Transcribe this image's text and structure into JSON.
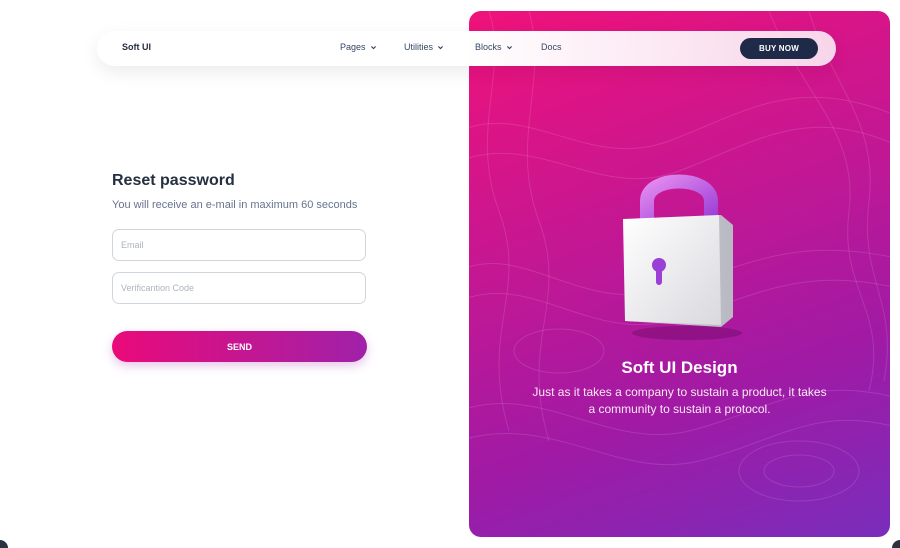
{
  "nav": {
    "brand": "Soft UI",
    "items": [
      {
        "label": "Pages",
        "icon": "chevron-down-icon"
      },
      {
        "label": "Utilities",
        "icon": "chevron-down-icon"
      },
      {
        "label": "Blocks",
        "icon": "chevron-down-icon"
      },
      {
        "label": "Docs"
      }
    ],
    "cta": "BUY NOW"
  },
  "form": {
    "title": "Reset password",
    "subtitle": "You will receive an e-mail in maximum 60 seconds",
    "email_placeholder": "Email",
    "code_placeholder": "Verificantion Code",
    "submit": "SEND"
  },
  "hero": {
    "title": "Soft UI Design",
    "text": "Just as it takes a company to sustain a product, it takes a community to sustain a protocol.",
    "icon": "lock-icon"
  },
  "colors": {
    "gradient_start": "#f0127a",
    "gradient_end": "#7a2dbc",
    "nav_button": "#1e2a48",
    "heading": "#252f40",
    "muted": "#67748e"
  }
}
